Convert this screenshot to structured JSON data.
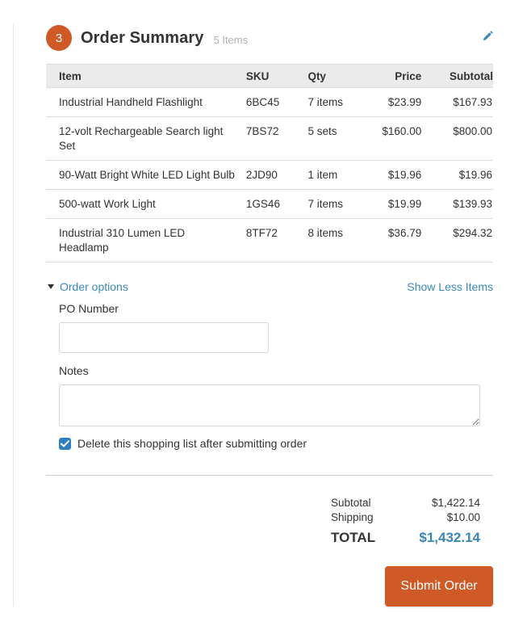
{
  "header": {
    "step_number": "3",
    "title": "Order Summary",
    "item_count": "5 Items"
  },
  "table": {
    "columns": [
      "Item",
      "SKU",
      "Qty",
      "Price",
      "Subtotal"
    ],
    "rows": [
      {
        "item": "Industrial Handheld Flashlight",
        "sku": "6BC45",
        "qty": "7 items",
        "price": "$23.99",
        "subtotal": "$167.93"
      },
      {
        "item": "12-volt Rechargeable Search light Set",
        "sku": "7BS72",
        "qty": "5 sets",
        "price": "$160.00",
        "subtotal": "$800.00"
      },
      {
        "item": "90-Watt Bright White LED Light Bulb",
        "sku": "2JD90",
        "qty": "1 item",
        "price": "$19.96",
        "subtotal": "$19.96"
      },
      {
        "item": "500-watt Work Light",
        "sku": "1GS46",
        "qty": "7 items",
        "price": "$19.99",
        "subtotal": "$139.93"
      },
      {
        "item": "Industrial 310 Lumen LED Headlamp",
        "sku": "8TF72",
        "qty": "8 items",
        "price": "$36.79",
        "subtotal": "$294.32"
      }
    ]
  },
  "options": {
    "toggle_label": "Order options",
    "show_less_label": "Show Less Items",
    "po_label": "PO Number",
    "po_value": "",
    "notes_label": "Notes",
    "notes_value": "",
    "delete_list_label": "Delete this shopping list after submitting order",
    "delete_list_checked": true
  },
  "totals": {
    "subtotal_label": "Subtotal",
    "subtotal_value": "$1,422.14",
    "shipping_label": "Shipping",
    "shipping_value": "$10.00",
    "total_label": "TOTAL",
    "total_value": "$1,432.14"
  },
  "actions": {
    "submit_label": "Submit Order"
  },
  "colors": {
    "accent_orange": "#d05a27",
    "link_blue": "#3a87b7",
    "checkbox_blue": "#2f7fc1"
  },
  "icons": {
    "edit": "pencil-icon",
    "toggle": "caret-down-icon",
    "checkbox": "check-icon"
  }
}
